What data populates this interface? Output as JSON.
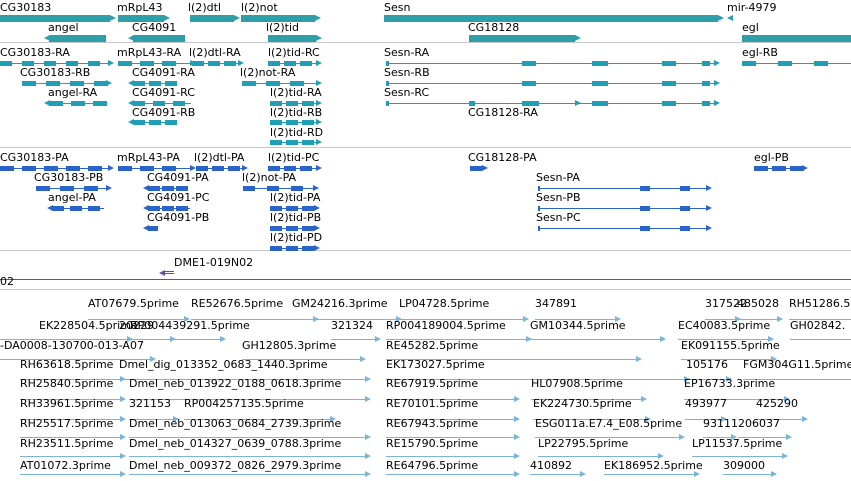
{
  "colors": {
    "gene": "#2e9ea8",
    "mrna": "#1f9fb5",
    "cds": "#2b64c8",
    "clone": "#6a4c9c",
    "est": "#7ab4d9",
    "separator": "#c8c8c8",
    "text": "#000000"
  },
  "tracks": {
    "genes": [
      {
        "label": "CG30183",
        "strand": "+"
      },
      {
        "label": "mRpL43",
        "strand": "+"
      },
      {
        "label": "l(2)dtl",
        "strand": "+"
      },
      {
        "label": "l(2)not",
        "strand": "+"
      },
      {
        "label": "Sesn",
        "strand": "+"
      },
      {
        "label": "mir-4979",
        "strand": "-"
      },
      {
        "label": "angel",
        "strand": "-"
      },
      {
        "label": "CG4091",
        "strand": "-"
      },
      {
        "label": "l(2)tid",
        "strand": "+"
      },
      {
        "label": "CG18128",
        "strand": "+"
      },
      {
        "label": "egl",
        "strand": "+"
      }
    ],
    "mrnas": [
      {
        "label": "CG30183-RA",
        "strand": "+"
      },
      {
        "label": "mRpL43-RA",
        "strand": "+"
      },
      {
        "label": "l(2)dtl-RA",
        "strand": "+"
      },
      {
        "label": "l(2)tid-RC",
        "strand": "+"
      },
      {
        "label": "Sesn-RA",
        "strand": "+"
      },
      {
        "label": "egl-RB",
        "strand": "+"
      },
      {
        "label": "CG30183-RB",
        "strand": "+"
      },
      {
        "label": "CG4091-RA",
        "strand": "-"
      },
      {
        "label": "l(2)not-RA",
        "strand": "+"
      },
      {
        "label": "Sesn-RB",
        "strand": "+"
      },
      {
        "label": "angel-RA",
        "strand": "-"
      },
      {
        "label": "CG4091-RC",
        "strand": "-"
      },
      {
        "label": "l(2)tid-RA",
        "strand": "+"
      },
      {
        "label": "Sesn-RC",
        "strand": "+"
      },
      {
        "label": "CG4091-RB",
        "strand": "-"
      },
      {
        "label": "l(2)tid-RB",
        "strand": "+"
      },
      {
        "label": "CG18128-RA",
        "strand": "+"
      },
      {
        "label": "l(2)tid-RD",
        "strand": "+"
      }
    ],
    "cds": [
      {
        "label": "CG30183-PA",
        "strand": "+"
      },
      {
        "label": "mRpL43-PA",
        "strand": "+"
      },
      {
        "label": "l(2)dtl-PA",
        "strand": "+"
      },
      {
        "label": "l(2)tid-PC",
        "strand": "+"
      },
      {
        "label": "CG18128-PA",
        "strand": "+"
      },
      {
        "label": "egl-PB",
        "strand": "+"
      },
      {
        "label": "CG30183-PB",
        "strand": "+"
      },
      {
        "label": "CG4091-PA",
        "strand": "-"
      },
      {
        "label": "l(2)not-PA",
        "strand": "+"
      },
      {
        "label": "Sesn-PA",
        "strand": "+"
      },
      {
        "label": "angel-PA",
        "strand": "-"
      },
      {
        "label": "CG4091-PC",
        "strand": "-"
      },
      {
        "label": "l(2)tid-PA",
        "strand": "+"
      },
      {
        "label": "Sesn-PB",
        "strand": "+"
      },
      {
        "label": "CG4091-PB",
        "strand": "-"
      },
      {
        "label": "l(2)tid-PB",
        "strand": "+"
      },
      {
        "label": "Sesn-PC",
        "strand": "+"
      },
      {
        "label": "l(2)tid-PD",
        "strand": "+"
      }
    ],
    "clones": [
      {
        "label": "DME1-019N02",
        "strand": "-"
      },
      {
        "label": "02",
        "strand": "+"
      }
    ],
    "ests": [
      {
        "label": "AT07679.5prime"
      },
      {
        "label": "RE52676.5prime"
      },
      {
        "label": "GM24216.3prime"
      },
      {
        "label": "LP04728.5prime"
      },
      {
        "label": "347891"
      },
      {
        "label": "317522"
      },
      {
        "label": "485028"
      },
      {
        "label": "RH51286.5"
      },
      {
        "label": "EK228504.5prime"
      },
      {
        "label": "20229"
      },
      {
        "label": "RP004439291.5prime"
      },
      {
        "label": "321324"
      },
      {
        "label": "RP004189004.5prime"
      },
      {
        "label": "GM10344.5prime"
      },
      {
        "label": "EC40083.5prime"
      },
      {
        "label": "GH02842."
      },
      {
        "label": "-DA0008-130700-013-A07"
      },
      {
        "label": "GH12805.3prime"
      },
      {
        "label": "RE45282.5prime"
      },
      {
        "label": "EK091155.5prime"
      },
      {
        "label": "RH63618.5prime"
      },
      {
        "label": "Dmel_dig_013352_0683_1440.3prime"
      },
      {
        "label": "EK173027.5prime"
      },
      {
        "label": "105176"
      },
      {
        "label": "FGM304G11.5prime"
      },
      {
        "label": "RH25840.5prime"
      },
      {
        "label": "Dmel_neb_013922_0188_0618.3prime"
      },
      {
        "label": "RE67919.5prime"
      },
      {
        "label": "HL07908.5prime"
      },
      {
        "label": "EP16733.3prime"
      },
      {
        "label": "RH33961.5prime"
      },
      {
        "label": "321153"
      },
      {
        "label": "RP004257135.5prime"
      },
      {
        "label": "RE70101.5prime"
      },
      {
        "label": "EK224730.5prime"
      },
      {
        "label": "493977"
      },
      {
        "label": "425290"
      },
      {
        "label": "RH25517.5prime"
      },
      {
        "label": "Dmel_neb_013063_0684_2739.3prime"
      },
      {
        "label": "RE67943.5prime"
      },
      {
        "label": "ESG011a.E7.4_E08.5prime"
      },
      {
        "label": "93111"
      },
      {
        "label": "206037"
      },
      {
        "label": "RH23511.5prime"
      },
      {
        "label": "Dmel_neb_014327_0639_0788.3prime"
      },
      {
        "label": "RE15790.5prime"
      },
      {
        "label": "LP22795.5prime"
      },
      {
        "label": "LP11537.5prime"
      },
      {
        "label": "AT01072.3prime"
      },
      {
        "label": "Dmel_neb_009372_0826_2979.3prime"
      },
      {
        "label": "RE64796.5prime"
      },
      {
        "label": "410892"
      },
      {
        "label": "EK186952.5prime"
      },
      {
        "label": "309000"
      }
    ]
  }
}
